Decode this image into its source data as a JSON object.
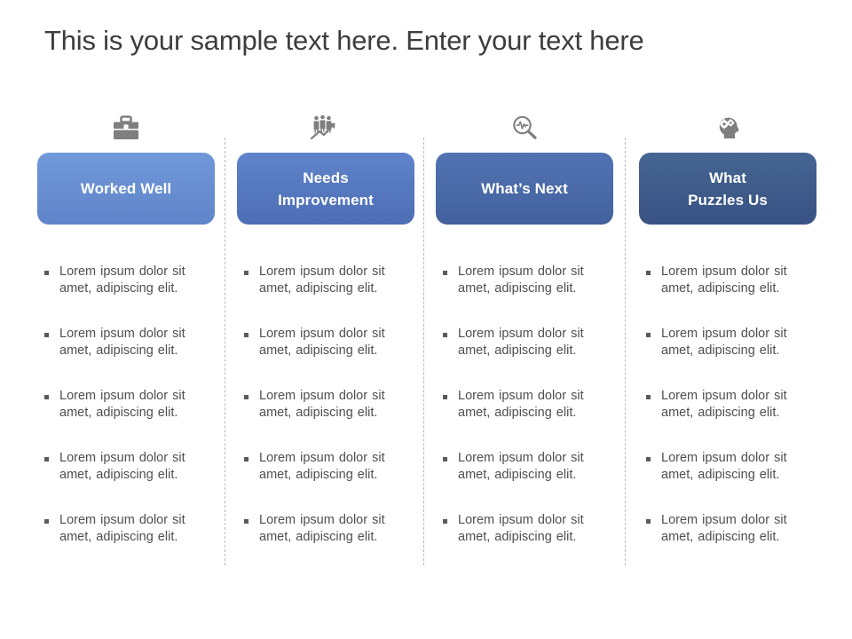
{
  "slide": {
    "title": "This is your sample text here. Enter your text here",
    "background_color": "#ffffff",
    "title_color": "#3d3d3d"
  },
  "columns": [
    {
      "icon": "briefcase-icon",
      "header": "Worked Well",
      "header_lines": [
        "Worked Well"
      ],
      "color": "#6690d4",
      "bullets": [
        "Lorem ipsum dolor sit amet, adipiscing elit.",
        "Lorem ipsum dolor sit amet, adipiscing elit.",
        "Lorem ipsum dolor sit amet, adipiscing elit.",
        "Lorem ipsum dolor sit amet, adipiscing elit.",
        "Lorem ipsum dolor sit amet, adipiscing elit."
      ]
    },
    {
      "icon": "people-growth-chart-icon",
      "header": "Needs Improvement",
      "header_lines": [
        "Needs",
        "Improvement"
      ],
      "color": "#5679bf",
      "bullets": [
        "Lorem ipsum dolor sit amet, adipiscing elit.",
        "Lorem ipsum dolor sit amet, adipiscing elit.",
        "Lorem ipsum dolor sit amet, adipiscing elit.",
        "Lorem ipsum dolor sit amet, adipiscing elit.",
        "Lorem ipsum dolor sit amet, adipiscing elit."
      ]
    },
    {
      "icon": "magnifier-pulse-icon",
      "header": "What’s Next",
      "header_lines": [
        "What’s Next"
      ],
      "color": "#4a6aa8",
      "bullets": [
        "Lorem ipsum dolor sit amet, adipiscing elit.",
        "Lorem ipsum dolor sit amet, adipiscing elit.",
        "Lorem ipsum dolor sit amet, adipiscing elit.",
        "Lorem ipsum dolor sit amet, adipiscing elit.",
        "Lorem ipsum dolor sit amet, adipiscing elit."
      ]
    },
    {
      "icon": "head-gears-icon",
      "header": "What Puzzles Us",
      "header_lines": [
        "What",
        "Puzzles Us"
      ],
      "color": "#3f5b8b",
      "bullets": [
        "Lorem ipsum dolor sit amet, adipiscing elit.",
        "Lorem ipsum dolor sit amet, adipiscing elit.",
        "Lorem ipsum dolor sit amet, adipiscing elit.",
        "Lorem ipsum dolor sit amet, adipiscing elit.",
        "Lorem ipsum dolor sit amet, adipiscing elit."
      ]
    }
  ],
  "divider_color": "#b9b9b9",
  "icon_color": "#7f7f7f",
  "bullet_marker_color": "#5a5a5a",
  "bullet_text_color": "#4f4f4f"
}
